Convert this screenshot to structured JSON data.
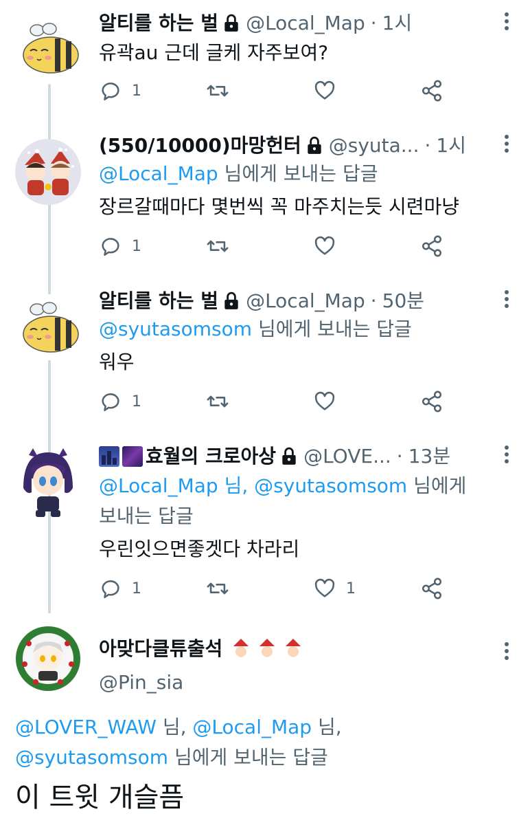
{
  "tweets": [
    {
      "name": "알티를 하는 벌",
      "handle": "@Local_Map",
      "time": "1시",
      "reply_mentions": "",
      "reply_suffix": "",
      "text": "유곽au 근데 글케 자주보여?",
      "replies": "1",
      "retweets": "",
      "likes": "",
      "avatar": "bee-avatar"
    },
    {
      "name": "(550/10000)마망헌터",
      "handle": "@syuta...",
      "time": "1시",
      "reply_mentions": "@Local_Map",
      "reply_suffix": "님에게 보내는 답글",
      "text": "장르갈때마다 몇번씩 꼭 마주치는듯 시련마냥",
      "replies": "1",
      "retweets": "",
      "likes": "",
      "avatar": "christmas-chibi-avatar"
    },
    {
      "name": "알티를 하는 벌",
      "handle": "@Local_Map",
      "time": "50분",
      "reply_mentions": "@syutasomsom",
      "reply_suffix": "님에게 보내는 답글",
      "text": "워우",
      "replies": "1",
      "retweets": "",
      "likes": "",
      "avatar": "bee-avatar"
    },
    {
      "name": "효월의 크로아상",
      "handle": "@LOVE...",
      "time": "13분",
      "reply_mentions_1": "@Local_Map",
      "reply_mid": "님,",
      "reply_mentions_2": "@syutasomsom",
      "reply_suffix_1": "님에게",
      "reply_suffix_2": "보내는 답글",
      "text": "우린잇으면좋겟다 차라리",
      "replies": "1",
      "retweets": "",
      "likes": "1",
      "avatar": "purple-hair-chibi-avatar"
    }
  ],
  "main_tweet": {
    "name": "아맞다클튜출석",
    "handle": "@Pin_sia",
    "reply_m1": "@LOVER_WAW",
    "reply_t1": "님,",
    "reply_m2": "@Local_Map",
    "reply_t2": "님,",
    "reply_m3": "@syutasomsom",
    "reply_t3": "님에게 보내는 답글",
    "text": "이 트윗 개슬픔",
    "avatar": "wreath-avatar"
  },
  "icons": {
    "reply": "reply-icon",
    "retweet": "retweet-icon",
    "like": "heart-icon",
    "share": "share-icon",
    "more": "more-icon",
    "lock": "lock-icon"
  },
  "colors": {
    "mention": "#1d9bf0",
    "muted": "#536471",
    "thread_line": "#cfd9de"
  }
}
